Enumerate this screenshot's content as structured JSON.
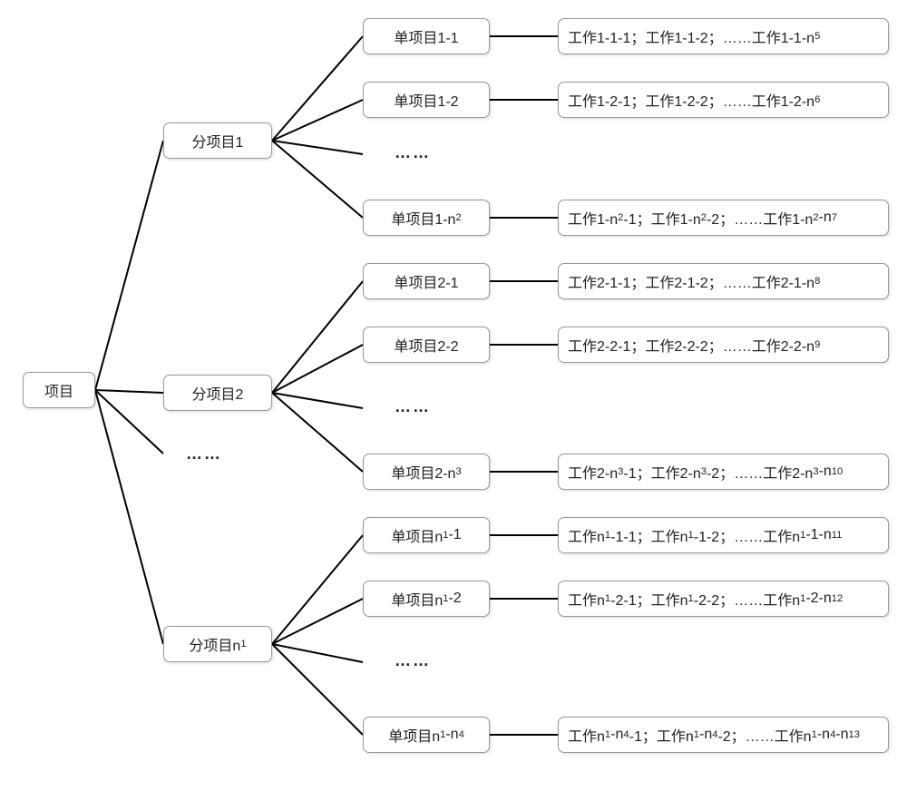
{
  "root": {
    "label": "项目"
  },
  "subprojects": {
    "sp1": {
      "label": "分项目1"
    },
    "sp2": {
      "label": "分项目2"
    },
    "spN": {
      "label_html": "分项目n<sub>1</sub>"
    },
    "ellipsis": "……"
  },
  "sub1_items": {
    "i1": {
      "label": "单项目1-1"
    },
    "i2": {
      "label": "单项目1-2"
    },
    "ellipsis": "……",
    "iN": {
      "label_html": "单项目1-n<sub>2</sub>"
    }
  },
  "sub2_items": {
    "i1": {
      "label": "单项目2-1"
    },
    "i2": {
      "label": "单项目2-2"
    },
    "ellipsis": "……",
    "iN": {
      "label_html": "单项目2-n<sub>3</sub>"
    }
  },
  "subN_items": {
    "i1": {
      "label_html": "单项目n<sub>1</sub>-1"
    },
    "i2": {
      "label_html": "单项目n<sub>1</sub>-2"
    },
    "ellipsis": "……",
    "iN": {
      "label_html": "单项目n<sub>1</sub>-n<sub>4</sub>"
    }
  },
  "work_rows": {
    "r11": {
      "label_html": "工作1-1-1；工作1-1-2；……工作1-1-n<sub>5</sub>"
    },
    "r12": {
      "label_html": "工作1-2-1；工作1-2-2；……工作1-2-n<sub>6</sub>"
    },
    "r1N": {
      "label_html": "工作1-n<sub>2</sub>-1；工作1-n<sub>2</sub>-2；……工作1-n<sub>2</sub>-n<sub>7</sub>"
    },
    "r21": {
      "label_html": "工作2-1-1；工作2-1-2；……工作2-1-n<sub>8</sub>"
    },
    "r22": {
      "label_html": "工作2-2-1；工作2-2-2；……工作2-2-n<sub>9</sub>"
    },
    "r2N": {
      "label_html": "工作2-n<sub>3</sub>-1；工作2-n<sub>3</sub>-2；……工作2-n<sub>3</sub>-n<sub>10</sub>"
    },
    "rN1": {
      "label_html": "工作n<sub>1</sub>-1-1；工作n<sub>1</sub>-1-2；……工作n<sub>1</sub>-1-n<sub>11</sub>"
    },
    "rN2": {
      "label_html": "工作n<sub>1</sub>-2-1；工作n<sub>1</sub>-2-2；……工作n<sub>1</sub>-2-n<sub>12</sub>"
    },
    "rNN": {
      "label_html": "工作n<sub>1</sub>-n<sub>4</sub>-1；工作n<sub>1</sub>-n<sub>4</sub>-2；……工作n<sub>1</sub>-n<sub>4</sub>-n<sub>13</sub>"
    }
  }
}
